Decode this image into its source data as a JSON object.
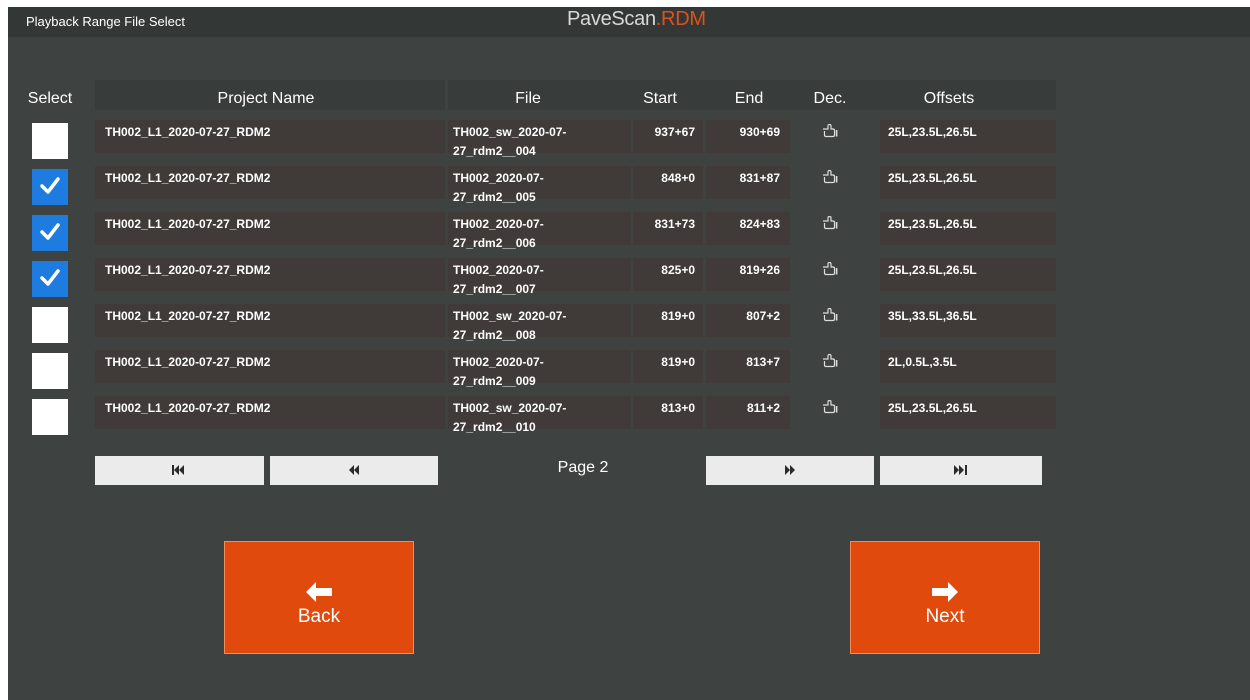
{
  "app": {
    "title": "Playback Range File Select",
    "brand_main": "PaveScan",
    "brand_accent": "RDM"
  },
  "columns": {
    "select": "Select",
    "project": "Project Name",
    "file": "File",
    "start": "Start",
    "end": "End",
    "dec": "Dec.",
    "offsets": "Offsets"
  },
  "rows": [
    {
      "checked": false,
      "project": "TH002_L1_2020-07-27_RDM2",
      "file_l1": "TH002_sw_2020-07-",
      "file_l2": "27_rdm2__004",
      "start": "937+67",
      "end": "930+69",
      "offsets": "25L,23.5L,26.5L"
    },
    {
      "checked": true,
      "project": "TH002_L1_2020-07-27_RDM2",
      "file_l1": "TH002_2020-07-",
      "file_l2": "27_rdm2__005",
      "start": "848+0",
      "end": "831+87",
      "offsets": "25L,23.5L,26.5L"
    },
    {
      "checked": true,
      "project": "TH002_L1_2020-07-27_RDM2",
      "file_l1": "TH002_2020-07-",
      "file_l2": "27_rdm2__006",
      "start": "831+73",
      "end": "824+83",
      "offsets": "25L,23.5L,26.5L"
    },
    {
      "checked": true,
      "project": "TH002_L1_2020-07-27_RDM2",
      "file_l1": "TH002_2020-07-",
      "file_l2": "27_rdm2__007",
      "start": "825+0",
      "end": "819+26",
      "offsets": "25L,23.5L,26.5L"
    },
    {
      "checked": false,
      "project": "TH002_L1_2020-07-27_RDM2",
      "file_l1": "TH002_sw_2020-07-",
      "file_l2": "27_rdm2__008",
      "start": "819+0",
      "end": "807+2",
      "offsets": "35L,33.5L,36.5L"
    },
    {
      "checked": false,
      "project": "TH002_L1_2020-07-27_RDM2",
      "file_l1": "TH002_2020-07-",
      "file_l2": "27_rdm2__009",
      "start": "819+0",
      "end": "813+7",
      "offsets": "2L,0.5L,3.5L"
    },
    {
      "checked": false,
      "project": "TH002_L1_2020-07-27_RDM2",
      "file_l1": "TH002_sw_2020-07-",
      "file_l2": "27_rdm2__010",
      "start": "813+0",
      "end": "811+2",
      "offsets": "25L,23.5L,26.5L"
    }
  ],
  "pager": {
    "page_label": "Page 2",
    "icons": [
      "first-page-icon",
      "previous-page-icon",
      "next-page-icon",
      "last-page-icon"
    ]
  },
  "actions": {
    "back_label": "Back",
    "next_label": "Next"
  },
  "colors": {
    "background": "#3e4341",
    "accent": "#e04a0d",
    "checkbox_on": "#1e7be0"
  }
}
